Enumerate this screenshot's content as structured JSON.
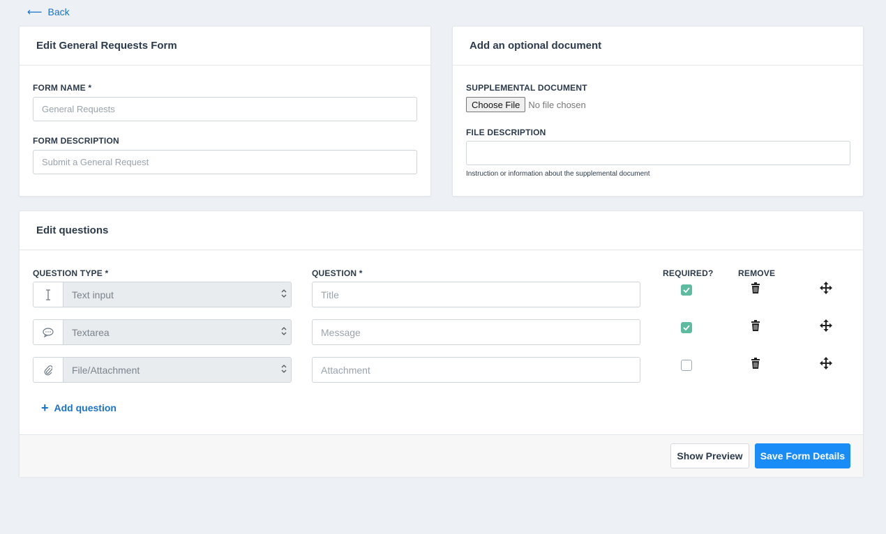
{
  "nav": {
    "back_label": "Back"
  },
  "form_card": {
    "title": "Edit General Requests Form",
    "name_label": "FORM NAME *",
    "name_placeholder": "General Requests",
    "description_label": "FORM DESCRIPTION",
    "description_placeholder": "Submit a General Request"
  },
  "document_card": {
    "title": "Add an optional document",
    "supplemental_label": "SUPPLEMENTAL DOCUMENT",
    "choose_file_label": "Choose File",
    "no_file_text": "No file chosen",
    "file_description_label": "FILE DESCRIPTION",
    "file_description_value": "",
    "help_text": "Instruction or information about the supplemental document"
  },
  "questions_card": {
    "title": "Edit questions",
    "columns": {
      "type": "QUESTION TYPE *",
      "question": "QUESTION *",
      "required": "REQUIRED?",
      "remove": "REMOVE"
    },
    "rows": [
      {
        "icon": "text-cursor-icon",
        "type": "Text input",
        "placeholder": "Title",
        "required": true
      },
      {
        "icon": "speech-bubble-icon",
        "type": "Textarea",
        "placeholder": "Message",
        "required": true
      },
      {
        "icon": "paperclip-icon",
        "type": "File/Attachment",
        "placeholder": "Attachment",
        "required": false
      }
    ],
    "add_question_label": "Add question"
  },
  "footer": {
    "preview_label": "Show Preview",
    "save_label": "Save Form Details"
  },
  "colors": {
    "accent": "#1a8cf8",
    "link": "#1a73c9",
    "checkbox_on": "#5dbb9f",
    "background": "#edf1f5"
  }
}
